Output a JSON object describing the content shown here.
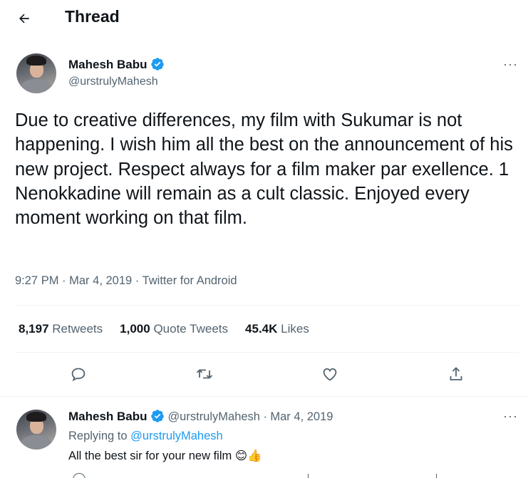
{
  "header": {
    "title": "Thread"
  },
  "tweet": {
    "author_name": "Mahesh Babu",
    "author_handle": "@urstrulyMahesh",
    "text": "Due to creative differences, my film with Sukumar is not happening. I wish him all the best on the announcement of his new project. Respect always for a film maker par exellence. 1 Nenokkadine will remain as a cult classic. Enjoyed every moment working on that film.",
    "time": "9:27 PM",
    "date": "Mar 4, 2019",
    "source": "Twitter for Android",
    "separator": "·",
    "more": "···"
  },
  "stats": {
    "retweets_count": "8,197",
    "retweets_label": "Retweets",
    "quotes_count": "1,000",
    "quotes_label": "Quote Tweets",
    "likes_count": "45.4K",
    "likes_label": "Likes"
  },
  "reply": {
    "author_name": "Mahesh Babu",
    "author_handle": "@urstrulyMahesh",
    "separator": "·",
    "date": "Mar 4, 2019",
    "replying_prefix": "Replying to",
    "replying_to": "@urstrulyMahesh",
    "text": "All the best sir for your new film",
    "emoji": "😊👍",
    "more": "···"
  },
  "colors": {
    "accent": "#1d9bf0",
    "text": "#0f1419",
    "secondary": "#536471",
    "divider": "#eff3f4"
  }
}
